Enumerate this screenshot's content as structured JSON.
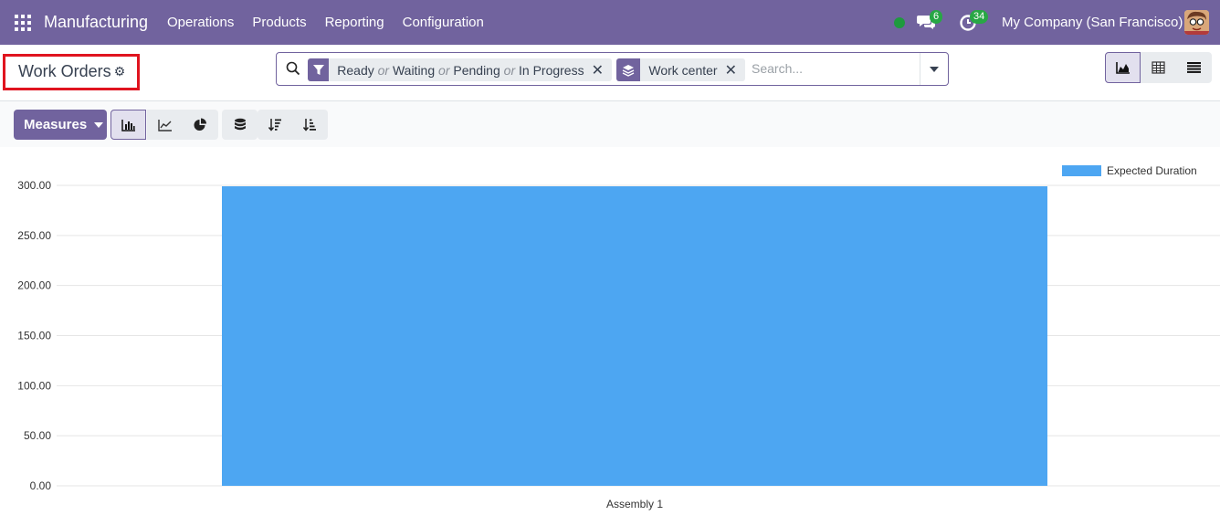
{
  "navbar": {
    "app_name": "Manufacturing",
    "menu": [
      "Operations",
      "Products",
      "Reporting",
      "Configuration"
    ],
    "messages_badge": "6",
    "activities_badge": "34",
    "company": "My Company (San Francisco)"
  },
  "control": {
    "breadcrumb": "Work Orders",
    "facets": [
      {
        "icon": "filter-icon",
        "parts": [
          "Ready",
          "or",
          "Waiting",
          "or",
          "Pending",
          "or",
          "In Progress"
        ]
      },
      {
        "icon": "layers-icon",
        "parts": [
          "Work center"
        ]
      }
    ],
    "search_placeholder": "Search..."
  },
  "graph": {
    "measures_label": "Measures",
    "bar_color": "#4da6f2"
  },
  "chart_data": {
    "type": "bar",
    "categories": [
      "Assembly 1"
    ],
    "series": [
      {
        "name": "Expected Duration",
        "values": [
          300
        ]
      }
    ],
    "ylim": [
      0,
      300
    ],
    "yticks": [
      "0.00",
      "50.00",
      "100.00",
      "150.00",
      "200.00",
      "250.00",
      "300.00"
    ],
    "legend": "top-right",
    "grid": true
  },
  "colors": {
    "brand": "#71639e",
    "bar": "#4da6f2"
  }
}
